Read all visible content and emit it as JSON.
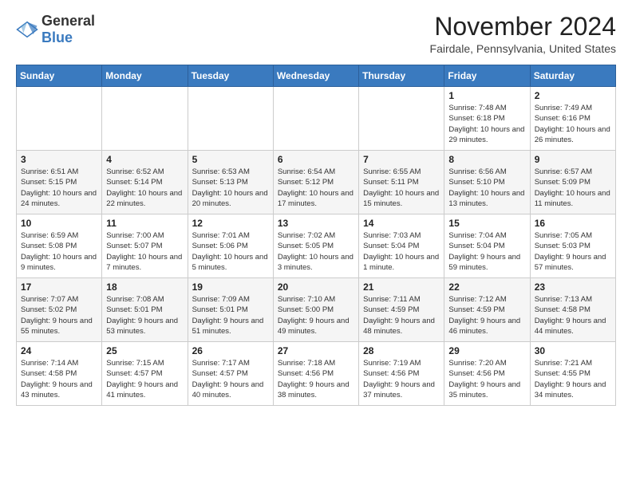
{
  "logo": {
    "general": "General",
    "blue": "Blue"
  },
  "title": "November 2024",
  "location": "Fairdale, Pennsylvania, United States",
  "days_of_week": [
    "Sunday",
    "Monday",
    "Tuesday",
    "Wednesday",
    "Thursday",
    "Friday",
    "Saturday"
  ],
  "weeks": [
    [
      {
        "day": "",
        "info": ""
      },
      {
        "day": "",
        "info": ""
      },
      {
        "day": "",
        "info": ""
      },
      {
        "day": "",
        "info": ""
      },
      {
        "day": "",
        "info": ""
      },
      {
        "day": "1",
        "info": "Sunrise: 7:48 AM\nSunset: 6:18 PM\nDaylight: 10 hours and 29 minutes."
      },
      {
        "day": "2",
        "info": "Sunrise: 7:49 AM\nSunset: 6:16 PM\nDaylight: 10 hours and 26 minutes."
      }
    ],
    [
      {
        "day": "3",
        "info": "Sunrise: 6:51 AM\nSunset: 5:15 PM\nDaylight: 10 hours and 24 minutes."
      },
      {
        "day": "4",
        "info": "Sunrise: 6:52 AM\nSunset: 5:14 PM\nDaylight: 10 hours and 22 minutes."
      },
      {
        "day": "5",
        "info": "Sunrise: 6:53 AM\nSunset: 5:13 PM\nDaylight: 10 hours and 20 minutes."
      },
      {
        "day": "6",
        "info": "Sunrise: 6:54 AM\nSunset: 5:12 PM\nDaylight: 10 hours and 17 minutes."
      },
      {
        "day": "7",
        "info": "Sunrise: 6:55 AM\nSunset: 5:11 PM\nDaylight: 10 hours and 15 minutes."
      },
      {
        "day": "8",
        "info": "Sunrise: 6:56 AM\nSunset: 5:10 PM\nDaylight: 10 hours and 13 minutes."
      },
      {
        "day": "9",
        "info": "Sunrise: 6:57 AM\nSunset: 5:09 PM\nDaylight: 10 hours and 11 minutes."
      }
    ],
    [
      {
        "day": "10",
        "info": "Sunrise: 6:59 AM\nSunset: 5:08 PM\nDaylight: 10 hours and 9 minutes."
      },
      {
        "day": "11",
        "info": "Sunrise: 7:00 AM\nSunset: 5:07 PM\nDaylight: 10 hours and 7 minutes."
      },
      {
        "day": "12",
        "info": "Sunrise: 7:01 AM\nSunset: 5:06 PM\nDaylight: 10 hours and 5 minutes."
      },
      {
        "day": "13",
        "info": "Sunrise: 7:02 AM\nSunset: 5:05 PM\nDaylight: 10 hours and 3 minutes."
      },
      {
        "day": "14",
        "info": "Sunrise: 7:03 AM\nSunset: 5:04 PM\nDaylight: 10 hours and 1 minute."
      },
      {
        "day": "15",
        "info": "Sunrise: 7:04 AM\nSunset: 5:04 PM\nDaylight: 9 hours and 59 minutes."
      },
      {
        "day": "16",
        "info": "Sunrise: 7:05 AM\nSunset: 5:03 PM\nDaylight: 9 hours and 57 minutes."
      }
    ],
    [
      {
        "day": "17",
        "info": "Sunrise: 7:07 AM\nSunset: 5:02 PM\nDaylight: 9 hours and 55 minutes."
      },
      {
        "day": "18",
        "info": "Sunrise: 7:08 AM\nSunset: 5:01 PM\nDaylight: 9 hours and 53 minutes."
      },
      {
        "day": "19",
        "info": "Sunrise: 7:09 AM\nSunset: 5:01 PM\nDaylight: 9 hours and 51 minutes."
      },
      {
        "day": "20",
        "info": "Sunrise: 7:10 AM\nSunset: 5:00 PM\nDaylight: 9 hours and 49 minutes."
      },
      {
        "day": "21",
        "info": "Sunrise: 7:11 AM\nSunset: 4:59 PM\nDaylight: 9 hours and 48 minutes."
      },
      {
        "day": "22",
        "info": "Sunrise: 7:12 AM\nSunset: 4:59 PM\nDaylight: 9 hours and 46 minutes."
      },
      {
        "day": "23",
        "info": "Sunrise: 7:13 AM\nSunset: 4:58 PM\nDaylight: 9 hours and 44 minutes."
      }
    ],
    [
      {
        "day": "24",
        "info": "Sunrise: 7:14 AM\nSunset: 4:58 PM\nDaylight: 9 hours and 43 minutes."
      },
      {
        "day": "25",
        "info": "Sunrise: 7:15 AM\nSunset: 4:57 PM\nDaylight: 9 hours and 41 minutes."
      },
      {
        "day": "26",
        "info": "Sunrise: 7:17 AM\nSunset: 4:57 PM\nDaylight: 9 hours and 40 minutes."
      },
      {
        "day": "27",
        "info": "Sunrise: 7:18 AM\nSunset: 4:56 PM\nDaylight: 9 hours and 38 minutes."
      },
      {
        "day": "28",
        "info": "Sunrise: 7:19 AM\nSunset: 4:56 PM\nDaylight: 9 hours and 37 minutes."
      },
      {
        "day": "29",
        "info": "Sunrise: 7:20 AM\nSunset: 4:56 PM\nDaylight: 9 hours and 35 minutes."
      },
      {
        "day": "30",
        "info": "Sunrise: 7:21 AM\nSunset: 4:55 PM\nDaylight: 9 hours and 34 minutes."
      }
    ]
  ]
}
